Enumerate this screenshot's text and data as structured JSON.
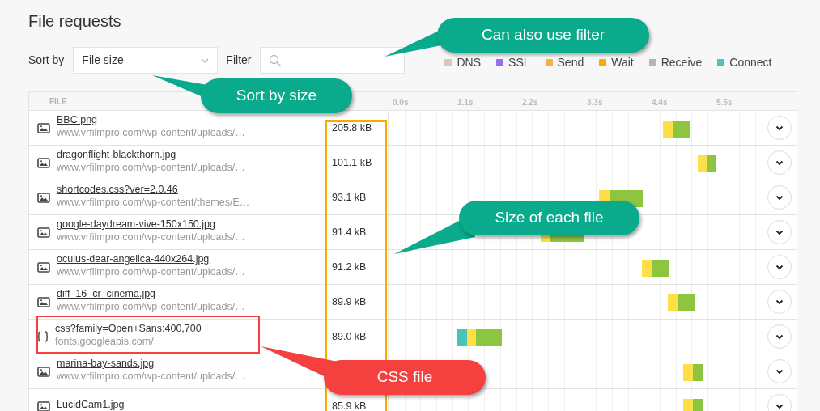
{
  "title": "File requests",
  "sort": {
    "label": "Sort by",
    "value": "File size"
  },
  "filter": {
    "label": "Filter"
  },
  "legend": [
    {
      "label": "DNS",
      "color": "#d9c7bd"
    },
    {
      "label": "SSL",
      "color": "#9b6cf0"
    },
    {
      "label": "Send",
      "color": "#f5b04f"
    },
    {
      "label": "Wait",
      "color": "#f7ab00"
    },
    {
      "label": "Receive",
      "color": "#b5b5b5"
    },
    {
      "label": "Connect",
      "color": "#48c4bd"
    }
  ],
  "table": {
    "columns": [
      "FILE"
    ],
    "ticks": [
      "0.0s",
      "1.1s",
      "2.2s",
      "3.3s",
      "4.4s",
      "5.5s"
    ],
    "rows": [
      {
        "kind": "image",
        "name": "BBC.png",
        "url": "www.vrfilmpro.com/wp-content/uploads/…",
        "size": "205.8 kB"
      },
      {
        "kind": "image",
        "name": "dragonflight-blackthorn.jpg",
        "url": "www.vrfilmpro.com/wp-content/uploads/…",
        "size": "101.1 kB"
      },
      {
        "kind": "image",
        "name": "shortcodes.css?ver=2.0.46",
        "url": "www.vrfilmpro.com/wp-content/themes/E…",
        "size": "93.1 kB"
      },
      {
        "kind": "image",
        "name": "google-daydream-vive-150x150.jpg",
        "url": "www.vrfilmpro.com/wp-content/uploads/…",
        "size": "91.4 kB"
      },
      {
        "kind": "image",
        "name": "oculus-dear-angelica-440x264.jpg",
        "url": "www.vrfilmpro.com/wp-content/uploads/…",
        "size": "91.2 kB"
      },
      {
        "kind": "image",
        "name": "diff_16_cr_cinema.jpg",
        "url": "www.vrfilmpro.com/wp-content/uploads/…",
        "size": "89.9 kB"
      },
      {
        "kind": "css",
        "name": "css?family=Open+Sans:400,700",
        "url": "fonts.googleapis.com/",
        "size": "89.0 kB"
      },
      {
        "kind": "image",
        "name": "marina-bay-sands.jpg",
        "url": "www.vrfilmpro.com/wp-content/uploads/…"
      },
      {
        "kind": "image",
        "name": "LucidCam1.jpg",
        "size": "85.9 kB"
      }
    ]
  },
  "callouts": [
    {
      "text": "Can also use filter",
      "color": "#0aab8c"
    },
    {
      "text": "Sort by size",
      "color": "#0aab8c"
    },
    {
      "text": "Size of each file",
      "color": "#0aab8c"
    },
    {
      "text": "CSS file",
      "color": "#f54040"
    }
  ]
}
